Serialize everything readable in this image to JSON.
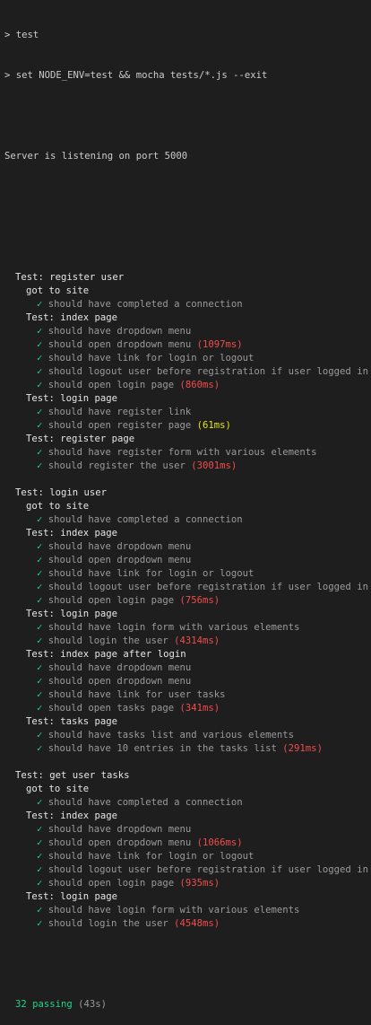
{
  "terminal": {
    "prompt1": "> test",
    "prompt2": "> set NODE_ENV=test && mocha tests/*.js --exit",
    "server": "Server is listening on port 5000",
    "check_glyph": "✓",
    "suites": [
      {
        "title": "Test: register user",
        "groups": [
          {
            "title": "got to site",
            "tests": [
              {
                "name": "should have completed a connection",
                "time": "",
                "speed": ""
              }
            ]
          },
          {
            "title": "Test: index page",
            "tests": [
              {
                "name": "should have dropdown menu",
                "time": "",
                "speed": ""
              },
              {
                "name": "should open dropdown menu",
                "time": "(1097ms)",
                "speed": "slow"
              },
              {
                "name": "should have link for login or logout",
                "time": "",
                "speed": ""
              },
              {
                "name": "should logout user before registration if user logged in",
                "time": "",
                "speed": ""
              },
              {
                "name": "should open login page",
                "time": "(860ms)",
                "speed": "slow"
              }
            ]
          },
          {
            "title": "Test: login page",
            "tests": [
              {
                "name": "should have register link",
                "time": "",
                "speed": ""
              },
              {
                "name": "should open register page",
                "time": "(61ms)",
                "speed": "medium"
              }
            ]
          },
          {
            "title": "Test: register page",
            "tests": [
              {
                "name": "should have register form with various elements",
                "time": "",
                "speed": ""
              },
              {
                "name": "should register the user",
                "time": "(3001ms)",
                "speed": "slow"
              }
            ]
          }
        ]
      },
      {
        "title": "Test: login user",
        "groups": [
          {
            "title": "got to site",
            "tests": [
              {
                "name": "should have completed a connection",
                "time": "",
                "speed": ""
              }
            ]
          },
          {
            "title": "Test: index page",
            "tests": [
              {
                "name": "should have dropdown menu",
                "time": "",
                "speed": ""
              },
              {
                "name": "should open dropdown menu",
                "time": "",
                "speed": ""
              },
              {
                "name": "should have link for login or logout",
                "time": "",
                "speed": ""
              },
              {
                "name": "should logout user before registration if user logged in",
                "time": "",
                "speed": ""
              },
              {
                "name": "should open login page",
                "time": "(756ms)",
                "speed": "slow"
              }
            ]
          },
          {
            "title": "Test: login page",
            "tests": [
              {
                "name": "should have login form with various elements",
                "time": "",
                "speed": ""
              },
              {
                "name": "should login the user",
                "time": "(4314ms)",
                "speed": "slow"
              }
            ]
          },
          {
            "title": "Test: index page after login",
            "tests": [
              {
                "name": "should have dropdown menu",
                "time": "",
                "speed": ""
              },
              {
                "name": "should open dropdown menu",
                "time": "",
                "speed": ""
              },
              {
                "name": "should have link for user tasks",
                "time": "",
                "speed": ""
              },
              {
                "name": "should open tasks page",
                "time": "(341ms)",
                "speed": "slow"
              }
            ]
          },
          {
            "title": "Test: tasks page",
            "tests": [
              {
                "name": "should have tasks list and various elements",
                "time": "",
                "speed": ""
              },
              {
                "name": "should have 10 entries in the tasks list",
                "time": "(291ms)",
                "speed": "slow"
              }
            ]
          }
        ]
      },
      {
        "title": "Test: get user tasks",
        "groups": [
          {
            "title": "got to site",
            "tests": [
              {
                "name": "should have completed a connection",
                "time": "",
                "speed": ""
              }
            ]
          },
          {
            "title": "Test: index page",
            "tests": [
              {
                "name": "should have dropdown menu",
                "time": "",
                "speed": ""
              },
              {
                "name": "should open dropdown menu",
                "time": "(1066ms)",
                "speed": "slow"
              },
              {
                "name": "should have link for login or logout",
                "time": "",
                "speed": ""
              },
              {
                "name": "should logout user before registration if user logged in",
                "time": "",
                "speed": ""
              },
              {
                "name": "should open login page",
                "time": "(935ms)",
                "speed": "slow"
              }
            ]
          },
          {
            "title": "Test: login page",
            "tests": [
              {
                "name": "should have login form with various elements",
                "time": "",
                "speed": ""
              },
              {
                "name": "should login the user",
                "time": "(4548ms)",
                "speed": "slow"
              }
            ]
          }
        ]
      }
    ],
    "summary": {
      "passing": "32 passing",
      "time": "(43s)"
    },
    "colors": {
      "background": "#1e1e1e",
      "pass": "#23d18b",
      "slow": "#f14c4c",
      "medium": "#e5e510",
      "muted": "#9a9a9a"
    }
  }
}
